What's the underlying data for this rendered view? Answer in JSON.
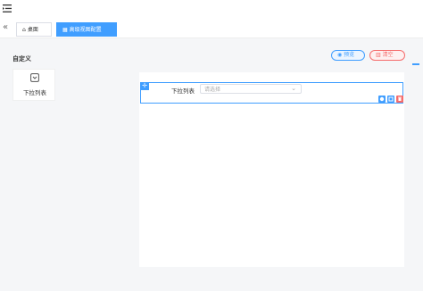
{
  "header": {
    "menu_icon": "hamburger-menu-icon"
  },
  "tabs": {
    "collapse_icon": "double-chevron-left-icon",
    "items": [
      {
        "label": "桌面",
        "icon": "home-icon",
        "active": false
      },
      {
        "label": "高级视图配置",
        "icon": "grid-icon",
        "active": true
      }
    ]
  },
  "left_panel": {
    "title": "自定义",
    "widgets": [
      {
        "label": "下拉列表",
        "icon": "select-box-icon"
      }
    ]
  },
  "toolbar": {
    "preview_label": "预览",
    "clear_label": "清空"
  },
  "form": {
    "fields": [
      {
        "label": "下拉列表",
        "placeholder": "请选择"
      }
    ]
  },
  "colors": {
    "primary": "#409eff",
    "danger": "#f56c6c",
    "background": "#f5f6f8"
  }
}
